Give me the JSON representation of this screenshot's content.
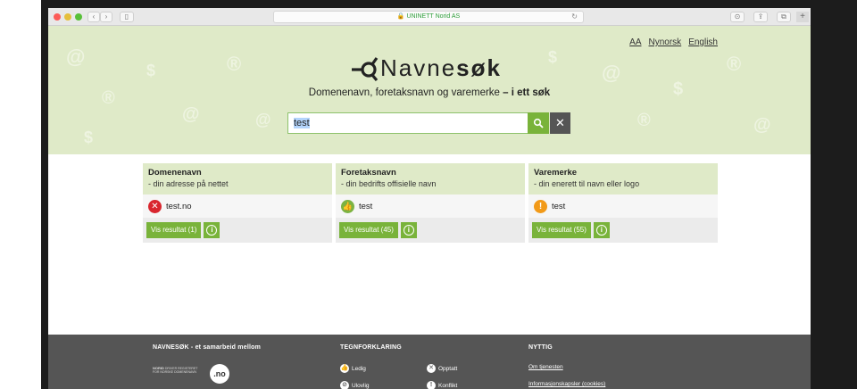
{
  "browser": {
    "address": "UNINETT Norid AS",
    "new_tab": "+"
  },
  "lang": {
    "aa": "AA",
    "nynorsk": "Nynorsk",
    "english": "English"
  },
  "logo": {
    "light": "Navne",
    "bold": "søk"
  },
  "tagline": {
    "main": "Domenenavn, foretaksnavn og varemerke",
    "bold": " – i ett søk"
  },
  "search": {
    "value": "test"
  },
  "cards": [
    {
      "title": "Domenenavn",
      "subtitle": "- din adresse på nettet",
      "result": "test.no",
      "status": "taken",
      "button": "Vis resultat (1)"
    },
    {
      "title": "Foretaksnavn",
      "subtitle": "- din bedrifts offisielle navn",
      "result": "test",
      "status": "free",
      "button": "Vis resultat (45)"
    },
    {
      "title": "Varemerke",
      "subtitle": "- din enerett til navn eller logo",
      "result": "test",
      "status": "warning",
      "button": "Vis resultat (55)"
    }
  ],
  "footer": {
    "col1": {
      "heading": "NAVNESØK - et samarbeid mellom",
      "norid_line1": "NORID",
      "norid_line2": "DRIVER REGISTERET",
      "norid_line3": "FOR NORSKE DOMENENAVN",
      "badge": ".no"
    },
    "col2": {
      "heading": "TEGNFORKLARING",
      "ledig": "Ledig",
      "opptatt": "Opptatt",
      "ulovlig": "Ulovlig",
      "konflikt": "Konflikt"
    },
    "col3": {
      "heading": "NYTTIG",
      "link1": "Om tjenesten",
      "link2": "Informasjonskapsler (cookies)"
    }
  },
  "colors": {
    "accent": "#79b33a",
    "hero_bg": "#dfeac8",
    "footer_bg": "#555555",
    "taken": "#d9262e",
    "warning": "#f29a18"
  }
}
